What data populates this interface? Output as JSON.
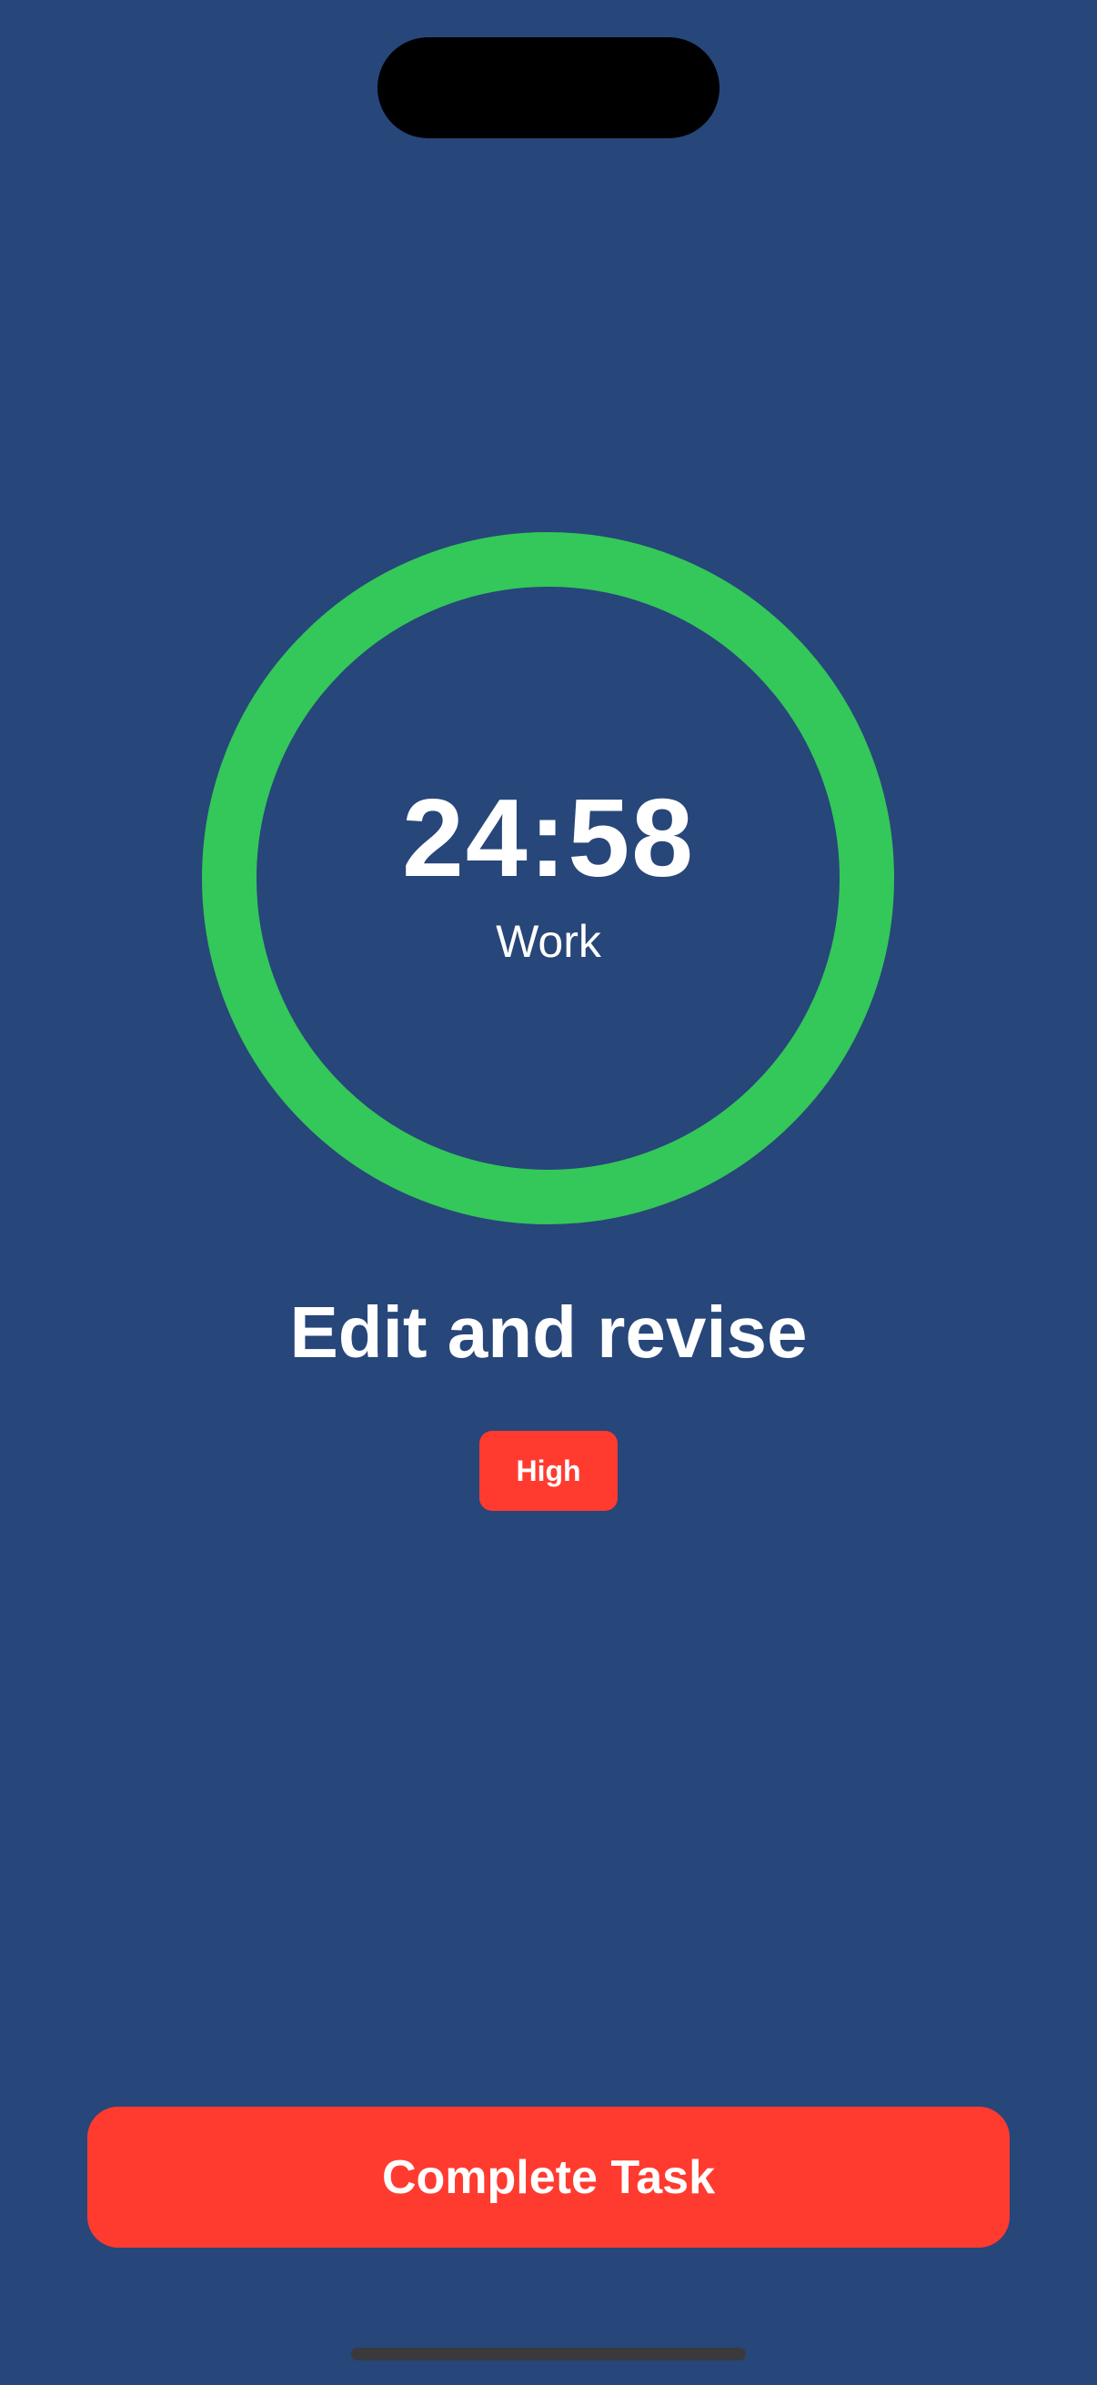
{
  "timer": {
    "display": "24:58",
    "mode_label": "Work",
    "ring_color": "#34c759"
  },
  "task": {
    "title": "Edit and revise",
    "priority": "High",
    "priority_color": "#ff3b30"
  },
  "actions": {
    "complete_label": "Complete Task",
    "complete_color": "#ff3b30"
  },
  "theme": {
    "background": "#27467a",
    "text": "#ffffff"
  }
}
